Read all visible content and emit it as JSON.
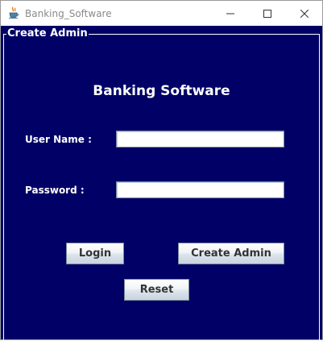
{
  "window": {
    "title": "Banking_Software",
    "icon": "java-cup-icon"
  },
  "panel": {
    "group_title": "Create Admin",
    "heading": "Banking Software"
  },
  "form": {
    "username_label": "User Name :",
    "username_value": "",
    "password_label": "Password :",
    "password_value": ""
  },
  "buttons": {
    "login": "Login",
    "create_admin": "Create Admin",
    "reset": "Reset"
  },
  "colors": {
    "background": "#000066",
    "text": "#ffffff"
  }
}
